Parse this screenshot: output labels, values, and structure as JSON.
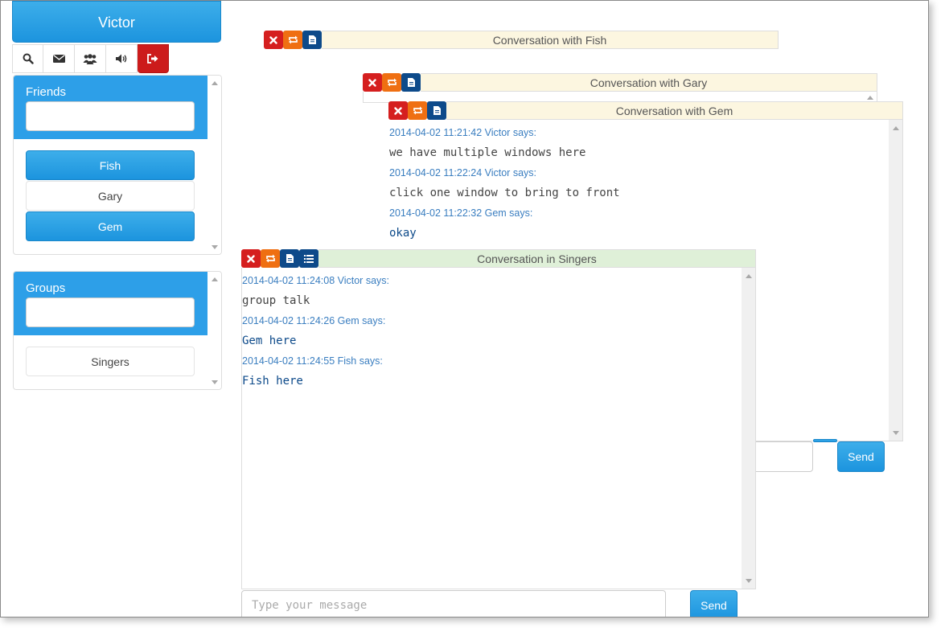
{
  "user": {
    "name": "Victor"
  },
  "toolbar": {
    "items": [
      {
        "icon": "search-icon"
      },
      {
        "icon": "envelope-icon"
      },
      {
        "icon": "users-icon"
      },
      {
        "icon": "volume-icon"
      },
      {
        "icon": "logout-icon"
      }
    ]
  },
  "friends": {
    "title": "Friends",
    "search_value": "",
    "items": [
      {
        "label": "Fish",
        "active": true
      },
      {
        "label": "Gary",
        "active": false
      },
      {
        "label": "Gem",
        "active": true
      }
    ]
  },
  "groups": {
    "title": "Groups",
    "search_value": "",
    "items": [
      {
        "label": "Singers",
        "active": false
      }
    ]
  },
  "windows": {
    "fish": {
      "title": "Conversation with Fish"
    },
    "gary": {
      "title": "Conversation with Gary"
    },
    "gem": {
      "title": "Conversation with Gem",
      "messages": [
        {
          "meta": "2014-04-02 11:21:42 Victor says:",
          "text": "we have multiple windows here"
        },
        {
          "meta": "2014-04-02 11:22:24 Victor says:",
          "text": "click one window to bring to front"
        },
        {
          "meta": "2014-04-02 11:22:32 Gem says:",
          "text": "okay"
        }
      ],
      "send_label": "Send"
    },
    "singers": {
      "title": "Conversation in Singers",
      "messages": [
        {
          "meta": "2014-04-02 11:24:08 Victor says:",
          "text": "group talk"
        },
        {
          "meta": "2014-04-02 11:24:26 Gem says:",
          "text": "Gem here"
        },
        {
          "meta": "2014-04-02 11:24:55 Fish says:",
          "text": "Fish here"
        }
      ],
      "input_placeholder": "Type your message",
      "send_label": "Send"
    }
  },
  "colors": {
    "primary": "#2d9fe8",
    "danger": "#d51f1f",
    "warning": "#ef6f12",
    "navy": "#0d4a8a",
    "header_yellow": "#fcf6e0",
    "header_green": "#dff0d8"
  }
}
